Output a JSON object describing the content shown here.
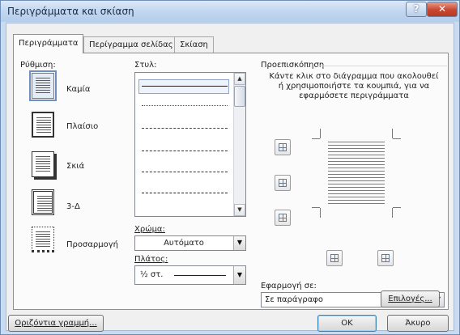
{
  "window": {
    "title": "Περιγράμματα και σκίαση"
  },
  "tabs": [
    {
      "label": "Περιγράμματα",
      "active": true
    },
    {
      "label": "Περίγραμμα σελίδας",
      "active": false
    },
    {
      "label": "Σκίαση",
      "active": false
    }
  ],
  "setting": {
    "label": "Ρύθμιση:",
    "options": [
      {
        "label": "Καμία",
        "selected": true
      },
      {
        "label": "Πλαίσιο",
        "selected": false
      },
      {
        "label": "Σκιά",
        "selected": false
      },
      {
        "label": "3-Δ",
        "selected": false
      },
      {
        "label": "Προσαρμογή",
        "selected": false
      }
    ]
  },
  "style": {
    "label": "Στυλ:",
    "lines": [
      "solid",
      "dotted",
      "dashed-small",
      "dashed",
      "dash-dot",
      "dash-dot-dot"
    ]
  },
  "color": {
    "label": "Χρώμα:",
    "value": "Αυτόματο"
  },
  "width": {
    "label": "Πλάτος:",
    "value": "½ στ."
  },
  "preview": {
    "label": "Προεπισκόπηση",
    "instructions": "Κάντε κλικ στο διάγραμμα που ακολουθεί ή χρησιμοποιήστε τα κουμπιά, για να εφαρμόσετε περιγράμματα"
  },
  "apply_to": {
    "label": "Εφαρμογή σε:",
    "value": "Σε παράγραφο"
  },
  "buttons": {
    "options": "Επιλογές...",
    "horizontal_line": "Οριζόντια γραμμή...",
    "ok": "OK",
    "cancel": "Άκυρο"
  },
  "colors": {
    "accent": "#3c7fb1",
    "titlebar": "#c3d8f1",
    "close": "#c8462f"
  }
}
